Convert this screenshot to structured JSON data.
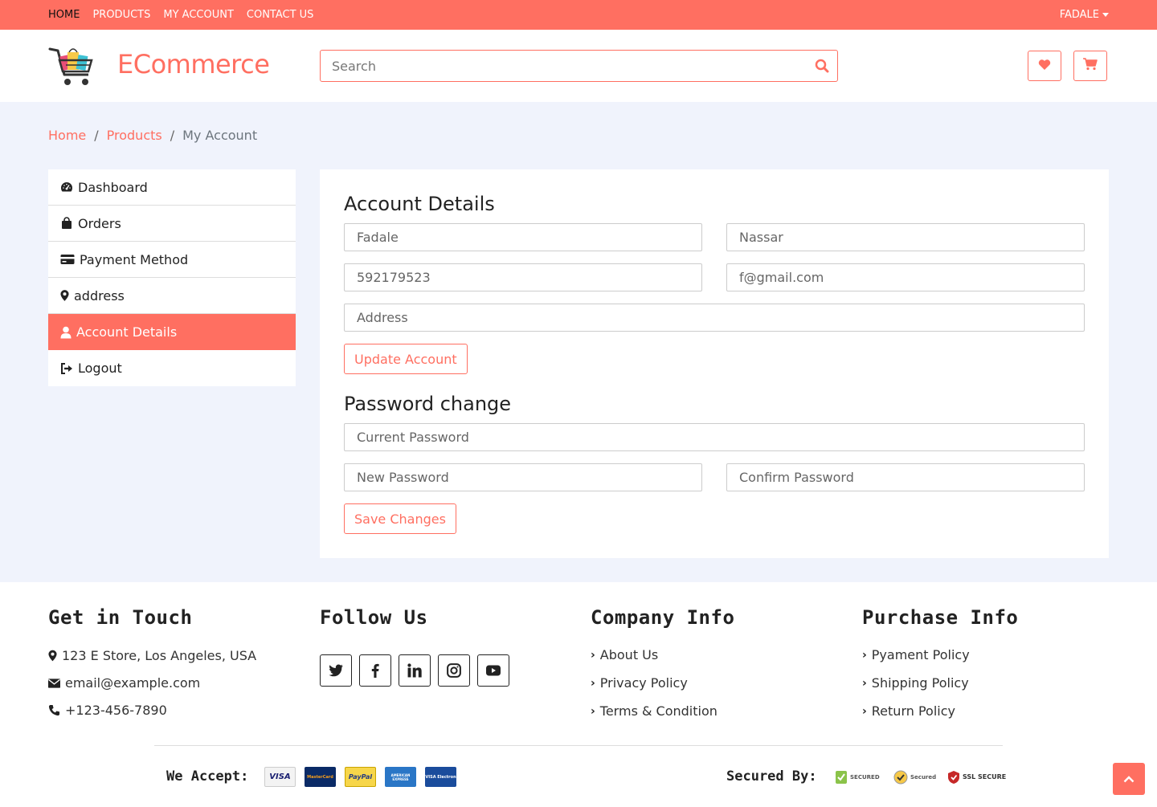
{
  "topbar": {
    "nav": [
      "HOME",
      "PRODUCTS",
      "MY ACCOUNT",
      "CONTACT US"
    ],
    "user": "FADALE",
    "bg": "#ff6f61"
  },
  "header": {
    "brand": "ECommerce",
    "search_placeholder": "Search",
    "icons": [
      "shopping-cart-logo",
      "search-icon",
      "heart-icon",
      "cart-icon"
    ]
  },
  "breadcrumb": {
    "items": [
      "Home",
      "Products",
      "My Account"
    ],
    "separator": "/"
  },
  "sidebar": {
    "items": [
      {
        "label": "Dashboard",
        "icon": "dashboard-icon"
      },
      {
        "label": "Orders",
        "icon": "shopping-bag-icon"
      },
      {
        "label": "Payment Method",
        "icon": "credit-card-icon"
      },
      {
        "label": "address",
        "icon": "map-marker-icon"
      },
      {
        "label": "Account Details",
        "icon": "user-icon",
        "active": true
      },
      {
        "label": "Logout",
        "icon": "sign-out-icon"
      }
    ]
  },
  "account": {
    "title": "Account Details",
    "first_name": "Fadale",
    "last_name": "Nassar",
    "phone": "592179523",
    "email": "f@gmail.com",
    "address_placeholder": "Address",
    "update_button": "Update Account"
  },
  "password": {
    "title": "Password change",
    "current_placeholder": "Current Password",
    "new_placeholder": "New Password",
    "confirm_placeholder": "Confirm Password",
    "save_button": "Save Changes"
  },
  "footer": {
    "contact": {
      "title": "Get in Touch",
      "address": "123 E Store, Los Angeles, USA",
      "email": "email@example.com",
      "phone": "+123-456-7890"
    },
    "follow": {
      "title": "Follow Us",
      "icons": [
        "twitter-icon",
        "facebook-icon",
        "linkedin-icon",
        "instagram-icon",
        "youtube-icon"
      ]
    },
    "company": {
      "title": "Company Info",
      "links": [
        "About Us",
        "Privacy Policy",
        "Terms & Condition"
      ]
    },
    "purchase": {
      "title": "Purchase Info",
      "links": [
        "Pyament Policy",
        "Shipping Policy",
        "Return Policy"
      ]
    },
    "accept_label": "We Accept:",
    "cards": [
      "VISA",
      "MasterCard",
      "PayPal",
      "AMERICAN EXPRESS",
      "VISA Electron"
    ],
    "secured_label": "Secured By:",
    "seals": [
      "SECURED",
      "Secured",
      "SSL SECURE"
    ]
  },
  "colors": {
    "accent": "#ff6f61",
    "main_bg": "#f0f3fc"
  }
}
